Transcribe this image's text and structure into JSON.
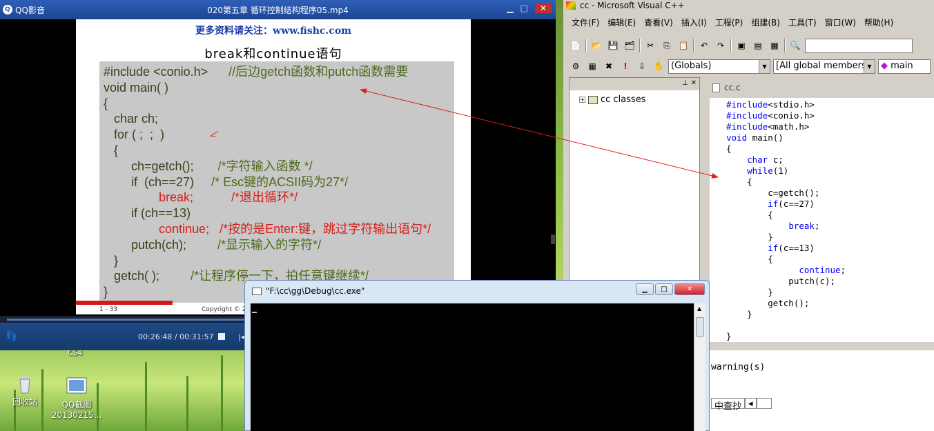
{
  "qq_player": {
    "app_name": "QQ影音",
    "file_title": "020第五章 循环控制结构程序05.mp4",
    "controls": {
      "minimize": "▁",
      "restore": "□",
      "close": "✕"
    },
    "time_display": "00:26:48 / 00:31:57",
    "progress": 0.44,
    "slide": {
      "link_text": "更多资料请关注：www.fishc.com",
      "title": "break和continue语句",
      "code_lines": [
        {
          "code": "#include <conio.h>",
          "comment": "      //后边getch函数和putch函数需要",
          "cls": ""
        },
        {
          "code": "void main( )",
          "comment": "",
          "cls": ""
        },
        {
          "code": "{",
          "comment": "",
          "cls": ""
        },
        {
          "code": "   char ch;",
          "comment": "",
          "cls": ""
        },
        {
          "code": "   for ( ;  ;  )",
          "comment": "",
          "cls": ""
        },
        {
          "code": "   {",
          "comment": "",
          "cls": ""
        },
        {
          "code": "        ch=getch();",
          "comment": "       /*字符输入函数 */",
          "cls": ""
        },
        {
          "code": "        if  (ch==27)",
          "comment": "     /* Esc键的ACSII码为27*/",
          "cls": ""
        },
        {
          "code": "                break;",
          "comment": "           /*退出循环*/",
          "cls": "red"
        },
        {
          "code": "        if (ch==13)",
          "comment": "",
          "cls": ""
        },
        {
          "code": "                continue;",
          "comment": "   /*按的是Enter:键，跳过字符输出语句*/",
          "cls": "red"
        },
        {
          "code": "        putch(ch);",
          "comment": "         /*显示输入的字符*/",
          "cls": ""
        },
        {
          "code": "   }",
          "comment": "",
          "cls": ""
        },
        {
          "code": "   getch( );",
          "comment": "         /*让程序停一下，拍任意键继续*/",
          "cls": ""
        },
        {
          "code": "}",
          "comment": "",
          "cls": ""
        }
      ],
      "footer_page": "1 - 33",
      "footer_copy": "Copyright © 20"
    }
  },
  "desktop": {
    "icons": [
      {
        "label": "回收站",
        "label2": ""
      },
      {
        "label": "QQ截图",
        "label2": "20130215..."
      }
    ],
    "cs4_label": "CS4"
  },
  "vcpp": {
    "title": "cc - Microsoft Visual C++",
    "menu": [
      "文件(F)",
      "编辑(E)",
      "查看(V)",
      "插入(I)",
      "工程(P)",
      "组建(B)",
      "工具(T)",
      "窗口(W)",
      "帮助(H)"
    ],
    "combo_globals": "(Globals)",
    "combo_members": "[All global members",
    "combo_main": "main",
    "workspace_item": "cc classes",
    "editor_tab": "cc.c",
    "code_lines": [
      "#include<stdio.h>",
      "#include<conio.h>",
      "#include<math.h>",
      "void main()",
      "{",
      "    char c;",
      "    while(1)",
      "    {",
      "        c=getch();",
      "        if(c==27)",
      "        {",
      "            break;",
      "        }",
      "        if(c==13)",
      "        {",
      "              continue;",
      "            putch(c);",
      "        }",
      "        getch();",
      "    }",
      "",
      "}"
    ],
    "output_text": "warning(s)",
    "output_tab": "中查抄"
  },
  "console": {
    "title": "\"F:\\cc\\gg\\Debug\\cc.exe\"",
    "controls": {
      "minimize": "▁",
      "restore": "□",
      "close": "✕"
    }
  }
}
